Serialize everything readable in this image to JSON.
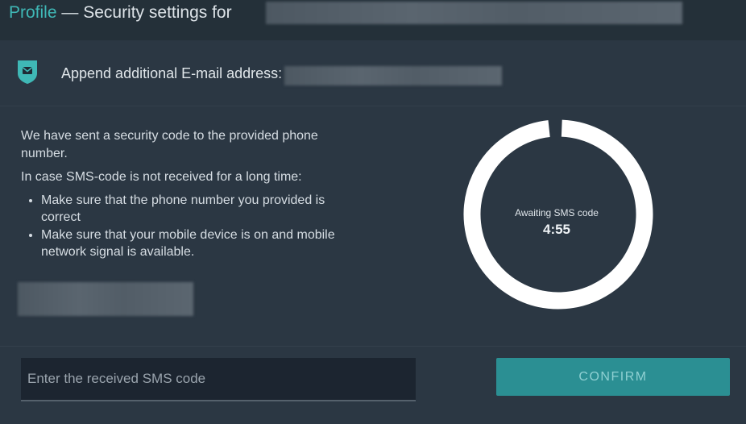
{
  "header": {
    "profile_link": "Profile",
    "title_rest": " — Security settings for"
  },
  "email": {
    "icon": "shield-mail-icon",
    "label": "Append additional E-mail address:"
  },
  "info": {
    "line1": "We have sent a security code to the provided phone number.",
    "line2": "In case SMS-code is not received for a long time:",
    "bullets": [
      "Make sure that the phone number you provided is correct",
      "Make sure that your mobile device is on and mobile network signal is available."
    ]
  },
  "timer": {
    "label": "Awaiting SMS code",
    "value": "4:55",
    "remaining_fraction": 0.983
  },
  "form": {
    "placeholder": "Enter the received SMS code",
    "value": "",
    "confirm_label": "CONFIRM"
  },
  "colors": {
    "accent": "#3fb8b6",
    "button": "#2b8f93",
    "background": "#2b3743",
    "ring": "#ffffff"
  }
}
